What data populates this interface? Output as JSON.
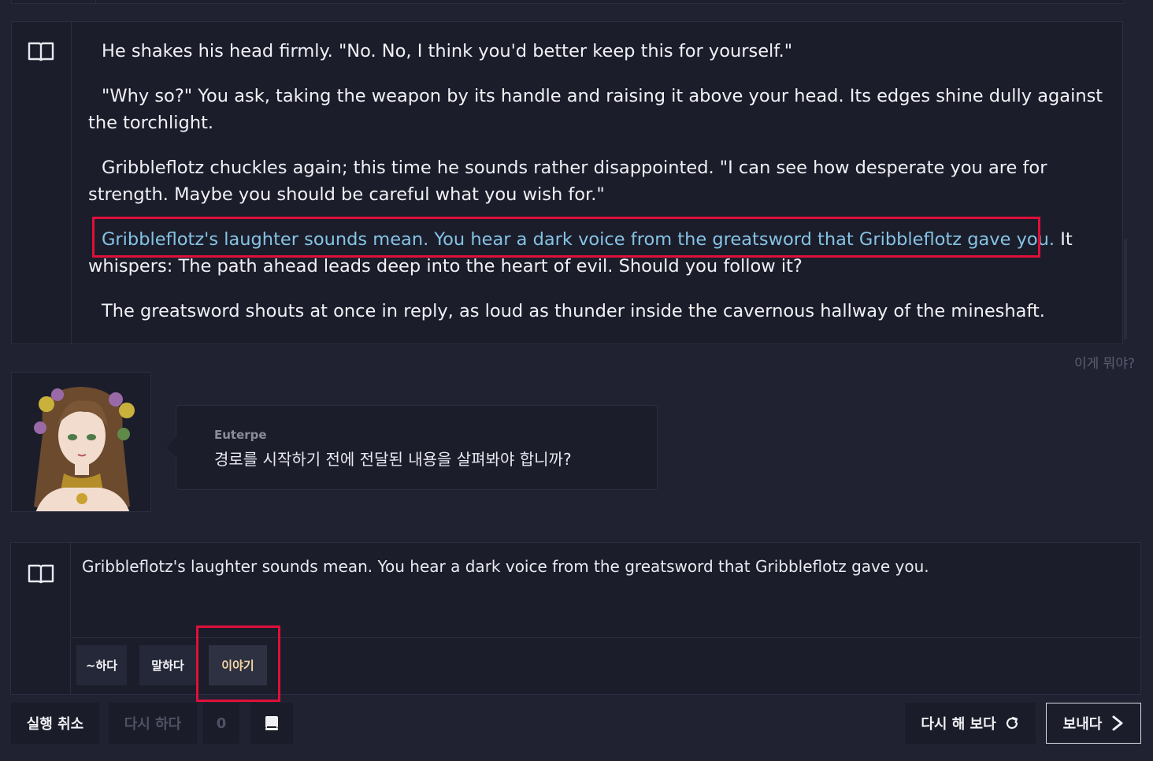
{
  "story": {
    "p1": "He shakes his head firmly. \"No. No, I think you'd better keep this for yourself.\"",
    "p2": "\"Why so?\" You ask, taking the weapon by its handle and raising it above your head. Its edges shine dully against the torchlight.",
    "p3": "Gribbleflotz chuckles again; this time he sounds rather disappointed. \"I can see how desperate you are for strength. Maybe you should be careful what you wish for.\"",
    "p4_highlight": "Gribbleflotz's laughter sounds mean. You hear a dark voice from the greatsword that Gribbleflotz gave you.",
    "p4_rest": " It whispers: The path ahead leads deep into the heart of evil. Should you follow it?",
    "p5": "The greatsword shouts at once in reply, as loud as thunder inside the cavernous hallway of the mineshaft."
  },
  "help_link": "이게 뭐야?",
  "assistant": {
    "name": "Euterpe",
    "message": "경로를 시작하기 전에 전달된 내용을 살펴봐야 합니까?"
  },
  "input": {
    "value": "Gribbleflotz's laughter sounds mean. You hear a dark voice from the greatsword that Gribbleflotz gave you."
  },
  "modes": [
    {
      "label": "~하다",
      "selected": false
    },
    {
      "label": "말하다",
      "selected": false
    },
    {
      "label": "이야기",
      "selected": true
    }
  ],
  "toolbar": {
    "undo": "실행 취소",
    "redo": "다시 하다",
    "count": "0",
    "retry": "다시 해 보다",
    "send": "보내다"
  },
  "icons": {
    "story_gutter": "book-open-icon",
    "input_gutter": "book-open-icon",
    "retry": "refresh-icon",
    "send": "arrow-right-icon",
    "memory": "book-icon"
  },
  "colors": {
    "background": "#202232",
    "panel": "#1b1d2b",
    "highlight_text": "#86c3e4",
    "annotation_box": "#e0103a",
    "selected_mode_text": "#f3d7a3"
  }
}
